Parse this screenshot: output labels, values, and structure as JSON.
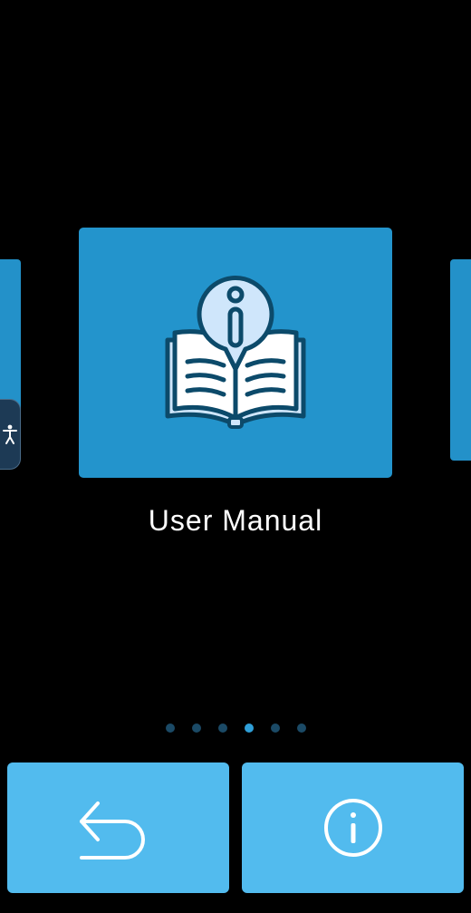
{
  "carousel": {
    "current_title": "User Manual",
    "current_icon": "book-info-icon",
    "page_count": 6,
    "active_index": 3
  },
  "accessibility": {
    "icon": "accessibility-person-icon"
  },
  "bottom_bar": {
    "back_icon": "back-arrow-icon",
    "info_icon": "info-circle-icon"
  },
  "colors": {
    "background": "#000000",
    "card": "#2394cc",
    "button": "#52bbee",
    "dot_inactive": "#1b4a66",
    "dot_active": "#2f9fd8"
  }
}
